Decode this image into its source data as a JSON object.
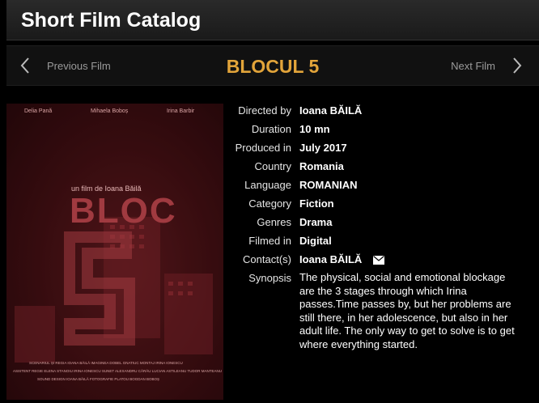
{
  "header": {
    "title": "Short Film Catalog"
  },
  "nav": {
    "prev_label": "Previous Film",
    "next_label": "Next Film",
    "film_title": "BLOCUL 5"
  },
  "poster": {
    "actors": [
      "Delia Pană",
      "Mihaela Boboș",
      "Irina Barbir"
    ],
    "tagline": "un film de Ioana Băilă",
    "title_word": "BLOC",
    "number": "5",
    "credits_line1": "SCENARIUL ȘI REGIA IOANA BĂILĂ   IMAGINEA DOBEL GNATIUC   MONTAJ IRINA IONESCU",
    "credits_line2": "ASISTENT REGIE ELENA STANOIU  IRINA IONESCU  SUNET ALEXANDRU CĂRĂU  LUCIAN ASTILEANU  TUDOR MANTEANU",
    "credits_line3": "SOUND DESIGN IOANA BĂILĂ   FOTOGRAFIE PLATOU BOGDAN BOBOȘ",
    "colors": {
      "bg": "#3a0d10",
      "accent": "#8a2a30"
    }
  },
  "details": [
    {
      "label": "Directed by",
      "value": "Ioana BĂILĂ"
    },
    {
      "label": "Duration",
      "value": "10 mn"
    },
    {
      "label": "Produced in",
      "value": "July 2017"
    },
    {
      "label": "Country",
      "value": "Romania"
    },
    {
      "label": "Language",
      "value": "ROMANIAN"
    },
    {
      "label": "Category",
      "value": "Fiction"
    },
    {
      "label": "Genres",
      "value": "Drama"
    },
    {
      "label": "Filmed in",
      "value": "Digital"
    },
    {
      "label": "Contact(s)",
      "value": "Ioana BĂILĂ",
      "icon": "mail-icon"
    },
    {
      "label": "Synopsis",
      "value": "The physical, social and emotional blockage are the 3 stages through which Irina passes.Time passes by, but her problems are still there, in her adolescence, but also in her adult life. The only way to get to solve is to get where everything started."
    }
  ],
  "colors": {
    "accent": "#e2a43a",
    "header_bg": "#222222",
    "nav_bg": "#111111"
  }
}
